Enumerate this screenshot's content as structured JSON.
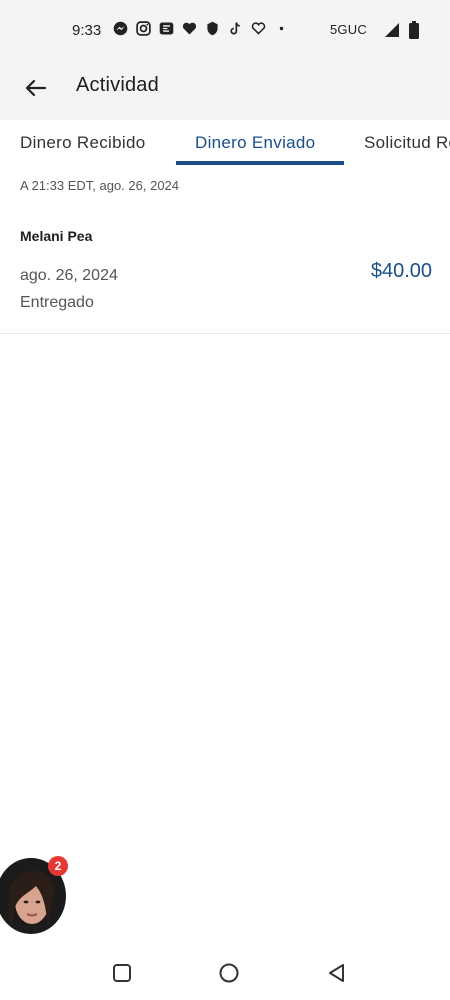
{
  "status_bar": {
    "time": "9:33",
    "network": "5GUC",
    "icons": [
      "messenger-icon",
      "instagram-icon",
      "app-icon",
      "hearts-icon",
      "shield-icon",
      "tiktok-icon",
      "heart-icon",
      "dot-icon"
    ]
  },
  "header": {
    "title": "Actividad",
    "back_icon": "back-arrow-icon"
  },
  "tabs": [
    {
      "label": "Dinero Recibido",
      "active": false
    },
    {
      "label": "Dinero Enviado",
      "active": true
    },
    {
      "label": "Solicitud Recibida",
      "active": false
    }
  ],
  "timestamp": "A 21:33 EDT, ago. 26, 2024",
  "transactions": [
    {
      "name": "Melani Pea",
      "date": "ago. 26, 2024",
      "status": "Entregado",
      "amount": "$40.00"
    }
  ],
  "chat_head": {
    "badge": "2"
  },
  "colors": {
    "accent": "#1a4f8a",
    "badge": "#e53935",
    "bar_background": "#f4f4f4"
  },
  "nav_bar": {
    "buttons": [
      "recents-icon",
      "home-icon",
      "back-icon"
    ]
  }
}
